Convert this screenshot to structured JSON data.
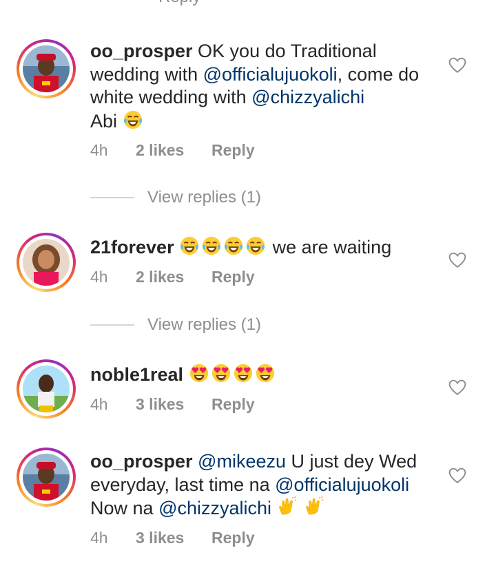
{
  "top_partial": {
    "text": "Reply"
  },
  "comments": [
    {
      "username": "oo_prosper",
      "pre": "OK you do Traditional wedding with",
      "mention1": "@officialujuokoli",
      "mid": ", come do white wedding with",
      "mention2": "@chizzyalichi",
      "post": "Abi",
      "emoji": "face-with-tears-of-joy",
      "time": "4h",
      "likes": "2 likes",
      "reply": "Reply",
      "view_replies": "View replies (1)"
    },
    {
      "username": "21forever",
      "text": "we are waiting",
      "emoji": "face-with-tears-of-joy",
      "emoji_count": 4,
      "time": "4h",
      "likes": "2 likes",
      "reply": "Reply",
      "view_replies": "View replies (1)"
    },
    {
      "username": "noble1real",
      "emoji": "smiling-face-with-heart-eyes",
      "emoji_count": 4,
      "time": "4h",
      "likes": "3 likes",
      "reply": "Reply"
    },
    {
      "username": "oo_prosper",
      "mention1": "@mikeezu",
      "mid": "U just dey Wed everyday, last time na",
      "mention2": "@officialujuokoli",
      "pre2": "Now na",
      "mention3": "@chizzyalichi",
      "emoji": "clapping-hands",
      "emoji_count": 2,
      "time": "4h",
      "likes": "3 likes",
      "reply": "Reply"
    }
  ],
  "colors": {
    "text": "#262626",
    "mention": "#003569",
    "meta": "#8e8e8e"
  }
}
